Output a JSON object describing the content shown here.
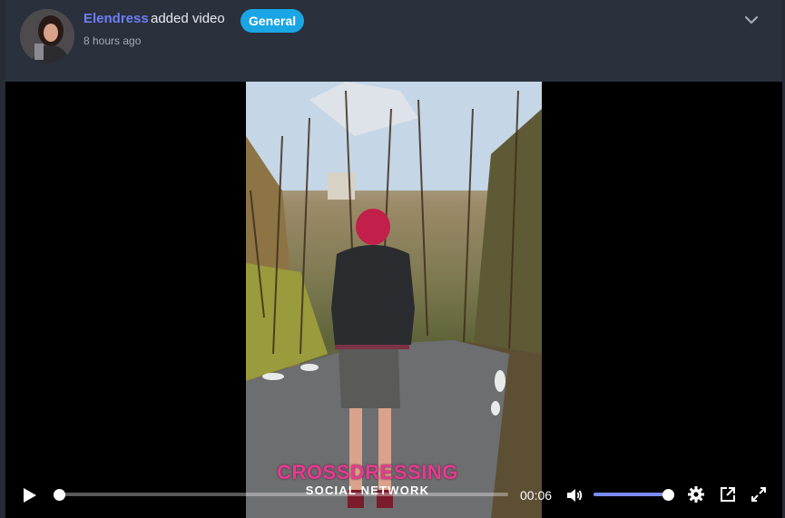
{
  "post": {
    "author": "Elendress",
    "action": "added video",
    "category": "General",
    "time_ago": "8 hours ago"
  },
  "video": {
    "watermark_title": "CROSSDRESSING",
    "watermark_subtitle": "SOCIAL NETWORK",
    "current_time": "00:06",
    "progress": 0.01,
    "volume": 1.0
  },
  "icons": {
    "menu": "chevron-down-icon",
    "play": "play-icon",
    "volume": "volume-icon",
    "settings": "gear-icon",
    "pip": "picture-in-picture-icon",
    "fullscreen": "fullscreen-icon"
  },
  "colors": {
    "author_link": "#6f7df6",
    "badge": "#1aa6e4",
    "volume_fill": "#7a8cff",
    "watermark": "#e33c8f"
  }
}
